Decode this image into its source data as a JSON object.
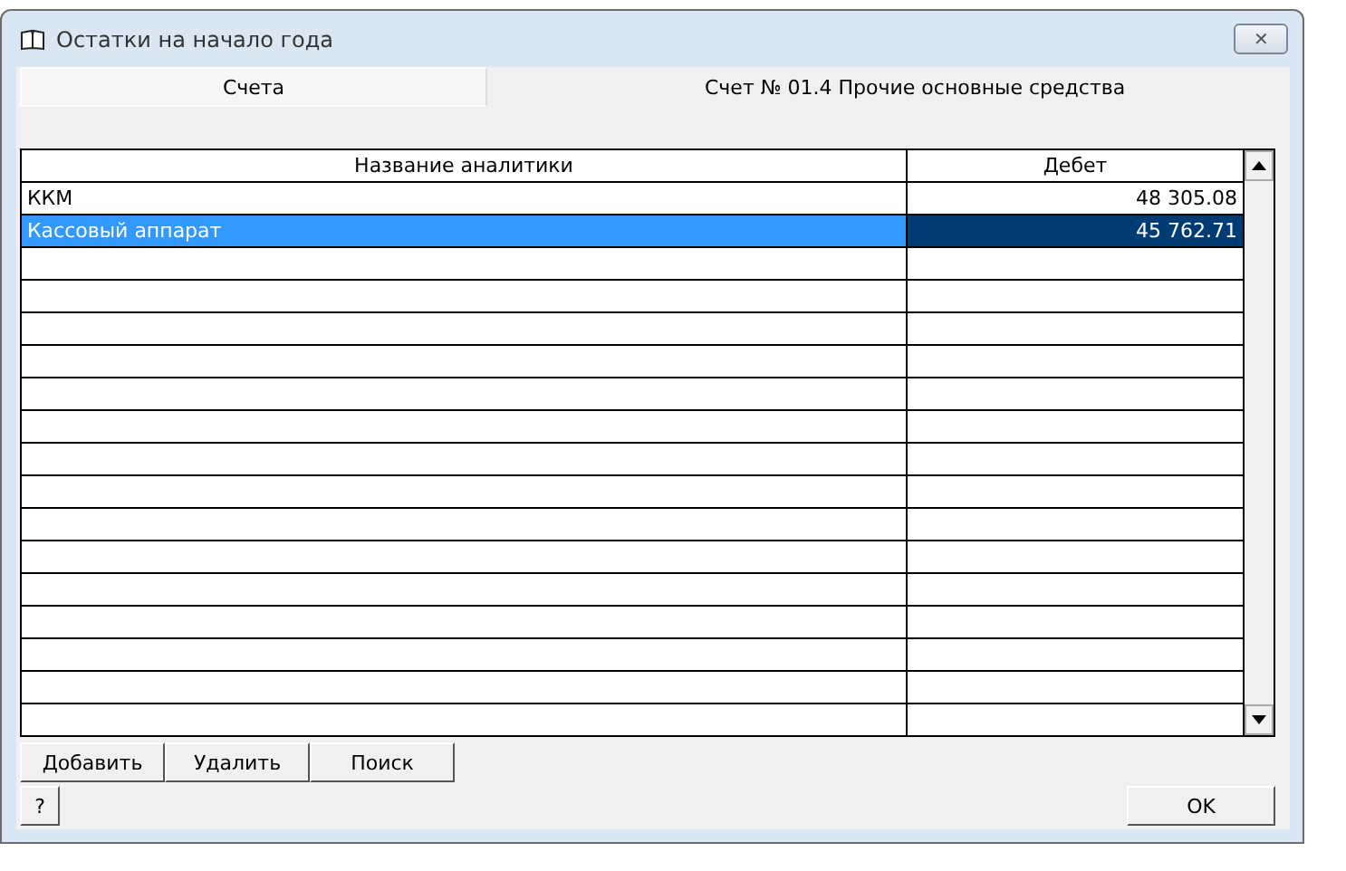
{
  "window": {
    "title": "Остатки на начало года",
    "close": "✕"
  },
  "tabs": [
    {
      "label": "Счета",
      "selected": false
    }
  ],
  "account": "Счет № 01.4  Прочие основные средства",
  "table": {
    "columns": [
      "Название аналитики",
      "Дебет"
    ],
    "rows": [
      {
        "name": "ККМ",
        "debit": "48 305.08",
        "selected": false
      },
      {
        "name": "Кассовый аппарат",
        "debit": "45 762.71",
        "selected": true
      }
    ]
  },
  "buttons": [
    "Добавить",
    "Удалить",
    "Поиск"
  ],
  "help_button": "?",
  "ok_button": "OK"
}
